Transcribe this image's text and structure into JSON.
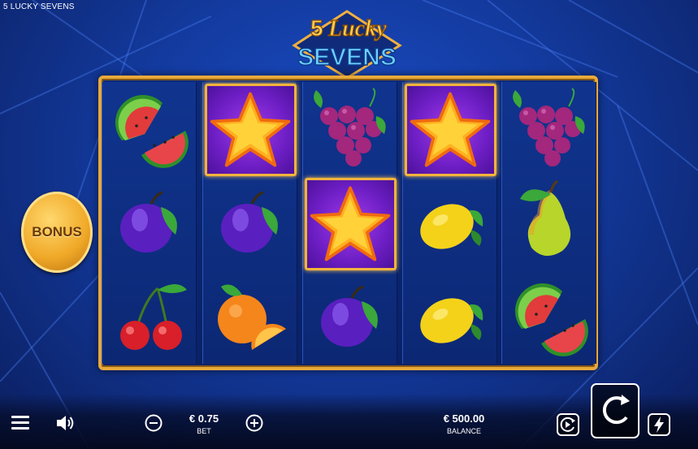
{
  "game": {
    "title": "5 LUCKY SEVENS"
  },
  "logo": {
    "number": "5",
    "word1": "Lucky",
    "word2": "SEVENS"
  },
  "bonus": {
    "label": "BONUS"
  },
  "reels": [
    [
      "watermelon",
      "plum",
      "cherry"
    ],
    [
      "star",
      "plum",
      "orange"
    ],
    [
      "grapes",
      "star",
      "plum"
    ],
    [
      "star",
      "lemon",
      "lemon"
    ],
    [
      "grapes",
      "pear",
      "watermelon"
    ]
  ],
  "winning_cells": [
    [
      1,
      0
    ],
    [
      3,
      0
    ],
    [
      2,
      1
    ]
  ],
  "bet": {
    "value": "€ 0.75",
    "label": "BET"
  },
  "balance": {
    "value": "€ 500.00",
    "label": "BALANCE"
  },
  "icons": {
    "menu": "menu-icon",
    "sound": "speaker-icon",
    "minus": "minus-icon",
    "plus": "plus-icon",
    "autoplay": "autoplay-icon",
    "spin": "spin-icon",
    "turbo": "lightning-icon"
  },
  "colors": {
    "frame": "#e8a93a",
    "win_bg": "#7a25d2",
    "background": "#133a9e"
  }
}
